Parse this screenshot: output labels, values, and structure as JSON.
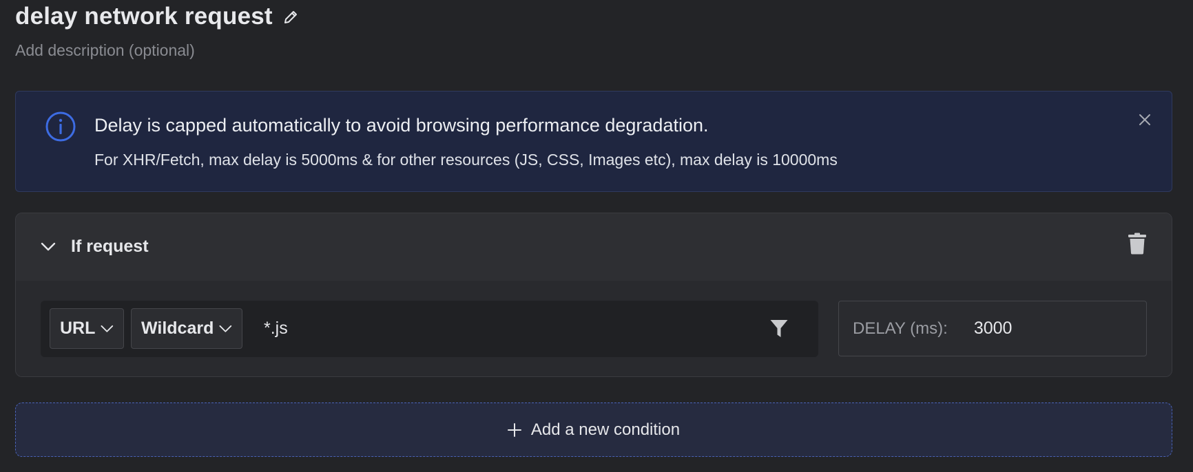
{
  "rule": {
    "title": "delay network request",
    "description_placeholder": "Add description (optional)"
  },
  "banner": {
    "title": "Delay is capped automatically to avoid browsing performance degradation.",
    "body": "For XHR/Fetch, max delay is 5000ms & for other resources (JS, CSS, Images etc), max delay is 10000ms",
    "icon": "info-icon",
    "accent_color": "#3d6ce3"
  },
  "condition": {
    "title": "If request",
    "source_type": "URL",
    "operator": "Wildcard",
    "pattern": "*.js",
    "delay_label": "DELAY (ms):",
    "delay_value": "3000"
  },
  "add_condition": {
    "label": "Add a new condition"
  }
}
